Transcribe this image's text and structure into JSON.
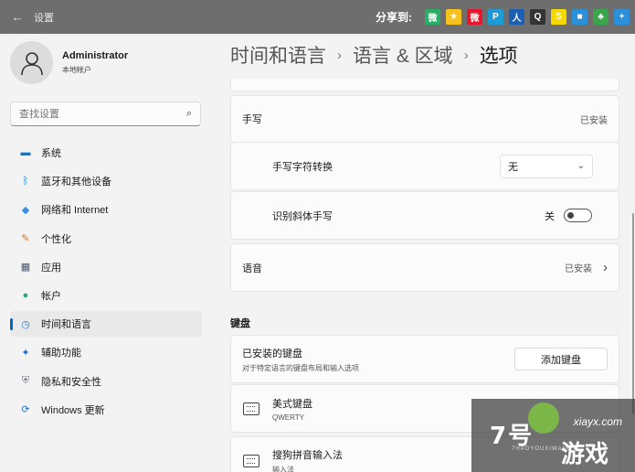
{
  "window": {
    "back_glyph": "←",
    "title": "设置"
  },
  "share": {
    "label": "分享到:",
    "icons": [
      {
        "name": "wechat",
        "color": "#2aae67",
        "glyph": "微"
      },
      {
        "name": "qzone",
        "color": "#f7c21b",
        "glyph": "★"
      },
      {
        "name": "weibo",
        "color": "#e6162d",
        "glyph": "微"
      },
      {
        "name": "pengyou",
        "color": "#1d9bd7",
        "glyph": "P"
      },
      {
        "name": "renren",
        "color": "#1a5fb4",
        "glyph": "人"
      },
      {
        "name": "qq",
        "color": "#333333",
        "glyph": "Q"
      },
      {
        "name": "sohu",
        "color": "#f5d800",
        "glyph": "S"
      },
      {
        "name": "book",
        "color": "#2b8fd9",
        "glyph": "■"
      },
      {
        "name": "clover",
        "color": "#3aa54a",
        "glyph": "♣"
      },
      {
        "name": "more",
        "color": "#2b8fd9",
        "glyph": "+"
      }
    ]
  },
  "user": {
    "name": "Administrator",
    "account_type": "本地帐户"
  },
  "search": {
    "placeholder": "查找设置"
  },
  "nav": {
    "items": [
      {
        "label": "系统",
        "icon": "system-icon",
        "color": "#0078d4",
        "glyph": "▬"
      },
      {
        "label": "蓝牙和其他设备",
        "icon": "bluetooth-icon",
        "color": "#0078d4",
        "glyph": "ᛒ"
      },
      {
        "label": "网络和 Internet",
        "icon": "wifi-icon",
        "color": "#3a8ee6",
        "glyph": "◆"
      },
      {
        "label": "个性化",
        "icon": "brush-icon",
        "color": "#c97a2c",
        "glyph": "✎"
      },
      {
        "label": "应用",
        "icon": "apps-icon",
        "color": "#4a5568",
        "glyph": "▦"
      },
      {
        "label": "帐户",
        "icon": "account-icon",
        "color": "#2aa876",
        "glyph": "●"
      },
      {
        "label": "时间和语言",
        "icon": "globe-clock-icon",
        "color": "#2b7cd3",
        "glyph": "◷"
      },
      {
        "label": "辅助功能",
        "icon": "accessibility-icon",
        "color": "#1f6fd1",
        "glyph": "✦"
      },
      {
        "label": "隐私和安全性",
        "icon": "shield-icon",
        "color": "#6b7280",
        "glyph": "⛨"
      },
      {
        "label": "Windows 更新",
        "icon": "update-icon",
        "color": "#1f6fd1",
        "glyph": "⟳"
      }
    ],
    "active_index": 6
  },
  "breadcrumb": {
    "part1": "时间和语言",
    "part2": "语言 & 区域",
    "current": "选项",
    "separator": "›"
  },
  "handwriting": {
    "label": "手写",
    "status": "已安装"
  },
  "handwriting_conversion": {
    "label": "手写字符转换",
    "value": "无",
    "chevron": "⌄"
  },
  "italic_recognition": {
    "label": "识别斜体手写",
    "state_label": "关"
  },
  "speech": {
    "label": "语音",
    "status": "已安装",
    "chevron": "›"
  },
  "keyboards": {
    "section_title": "键盘",
    "installed_label": "已安装的键盘",
    "installed_desc": "对于特定语言的键盘布局和输入选项",
    "add_button": "添加键盘",
    "items": [
      {
        "name": "美式键盘",
        "sub": "QWERTY"
      },
      {
        "name": "搜狗拼音输入法",
        "sub": "输入法"
      }
    ]
  },
  "watermark": {
    "url": "xiayx.com",
    "big": "7号",
    "small": "7HAOYOUXIWANG",
    "game": "游戏"
  }
}
